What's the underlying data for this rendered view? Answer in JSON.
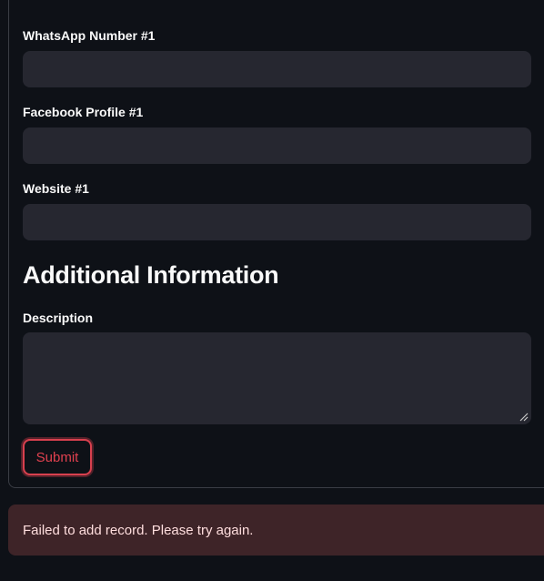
{
  "form": {
    "fields": [
      {
        "label": "WhatsApp Number #1",
        "value": "",
        "placeholder": ""
      },
      {
        "label": "Facebook Profile #1",
        "value": "",
        "placeholder": ""
      },
      {
        "label": "Website #1",
        "value": "",
        "placeholder": ""
      }
    ],
    "section_heading": "Additional Information",
    "description": {
      "label": "Description",
      "value": "",
      "placeholder": ""
    },
    "submit_label": "Submit"
  },
  "alert": {
    "message": "Failed to add record. Please try again.",
    "type": "error"
  },
  "colors": {
    "background": "#0e1117",
    "input_background": "#262730",
    "accent": "#e0414f",
    "error_background": "#3e2428",
    "text": "#fafafa"
  },
  "icons": {
    "collapse": "chevron-up-icon",
    "resize": "resize-grip-icon"
  }
}
